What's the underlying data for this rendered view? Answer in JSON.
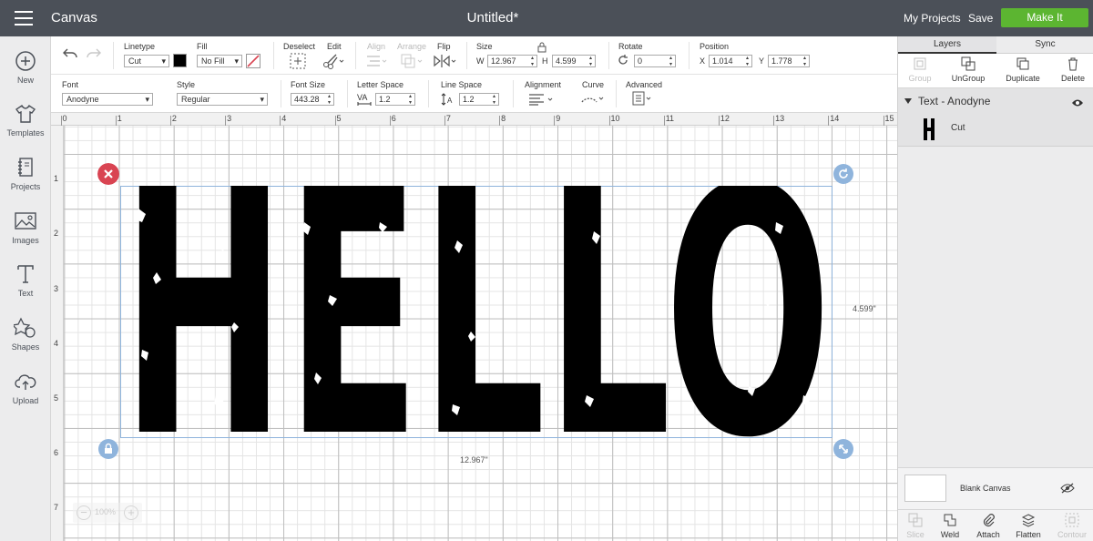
{
  "header": {
    "app_title": "Canvas",
    "doc_title": "Untitled*",
    "my_projects": "My Projects",
    "save": "Save",
    "make_it": "Make It"
  },
  "nav": [
    {
      "label": "New",
      "icon": "plus-circle-icon"
    },
    {
      "label": "Templates",
      "icon": "shirt-icon"
    },
    {
      "label": "Projects",
      "icon": "notebook-icon"
    },
    {
      "label": "Images",
      "icon": "image-icon"
    },
    {
      "label": "Text",
      "icon": "text-t-icon"
    },
    {
      "label": "Shapes",
      "icon": "shapes-icon"
    },
    {
      "label": "Upload",
      "icon": "cloud-upload-icon"
    }
  ],
  "toolbar1": {
    "linetype_label": "Linetype",
    "linetype_value": "Cut",
    "fill_label": "Fill",
    "fill_value": "No Fill",
    "deselect_label": "Deselect",
    "edit_label": "Edit",
    "align_label": "Align",
    "arrange_label": "Arrange",
    "flip_label": "Flip",
    "size_label": "Size",
    "w_label": "W",
    "w_value": "12.967",
    "h_label": "H",
    "h_value": "4.599",
    "rotate_label": "Rotate",
    "rotate_value": "0",
    "position_label": "Position",
    "x_label": "X",
    "x_value": "1.014",
    "y_label": "Y",
    "y_value": "1.778"
  },
  "toolbar2": {
    "font_label": "Font",
    "font_value": "Anodyne",
    "style_label": "Style",
    "style_value": "Regular",
    "font_size_label": "Font Size",
    "font_size_value": "443.28",
    "letter_space_label": "Letter Space",
    "letter_space_value": "1.2",
    "line_space_label": "Line Space",
    "line_space_value": "1.2",
    "alignment_label": "Alignment",
    "curve_label": "Curve",
    "advanced_label": "Advanced"
  },
  "canvas": {
    "ruler_top": [
      "0",
      "1",
      "2",
      "3",
      "4",
      "5",
      "6",
      "7",
      "8",
      "9",
      "10",
      "11",
      "12",
      "13",
      "14",
      "15"
    ],
    "ruler_left": [
      "1",
      "2",
      "3",
      "4",
      "5",
      "6",
      "7",
      "8"
    ],
    "text": "HELLO",
    "dim_height": "4.599\"",
    "dim_width": "12.967\"",
    "zoom": "100%"
  },
  "panel": {
    "tab_layers": "Layers",
    "tab_sync": "Sync",
    "tools": [
      "Group",
      "UnGroup",
      "Duplicate",
      "Delete"
    ],
    "group_title": "Text - Anodyne",
    "item_label": "Cut",
    "blank_canvas": "Blank Canvas",
    "bottom_tools": [
      "Slice",
      "Weld",
      "Attach",
      "Flatten",
      "Contour"
    ]
  },
  "colors": {
    "topbar": "#4b5058",
    "make_it": "#5cb531",
    "delete_handle": "#d94452",
    "handle": "#8fb4dc"
  }
}
